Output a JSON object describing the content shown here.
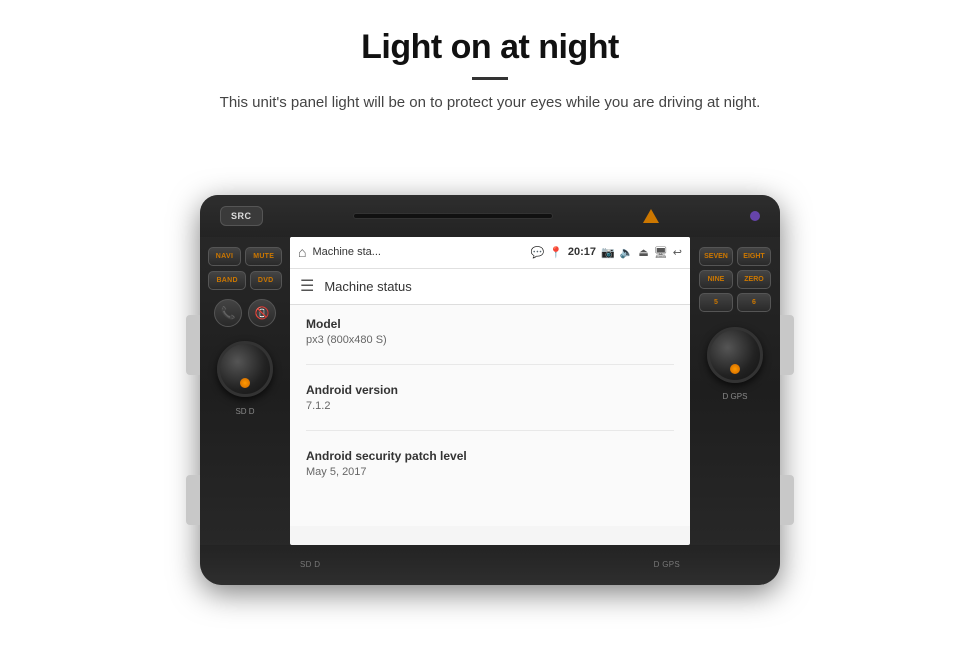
{
  "header": {
    "title": "Light on at night",
    "subtitle": "This unit's panel light will be on to protect your eyes while you are driving at night."
  },
  "radio": {
    "top_button": "SRC",
    "purple_dot": true,
    "left_buttons": [
      {
        "label": "NAVI"
      },
      {
        "label": "MUTE"
      },
      {
        "label": "BAND"
      },
      {
        "label": "DVD"
      }
    ],
    "right_buttons": [
      {
        "label": "SEVEN"
      },
      {
        "label": "EIGHT"
      },
      {
        "label": "NINE"
      },
      {
        "label": "ZERO"
      },
      {
        "label": "5"
      },
      {
        "label": "6"
      }
    ],
    "bottom_left_label": "SD  D",
    "bottom_right_label": "D  GPS"
  },
  "android": {
    "status_bar": {
      "app_name": "Machine sta...",
      "time": "20:17"
    },
    "toolbar": {
      "title": "Machine status"
    },
    "info_items": [
      {
        "label": "Model",
        "value": "px3 (800x480 S)"
      },
      {
        "label": "Android version",
        "value": "7.1.2"
      },
      {
        "label": "Android security patch level",
        "value": "May 5, 2017"
      }
    ]
  }
}
